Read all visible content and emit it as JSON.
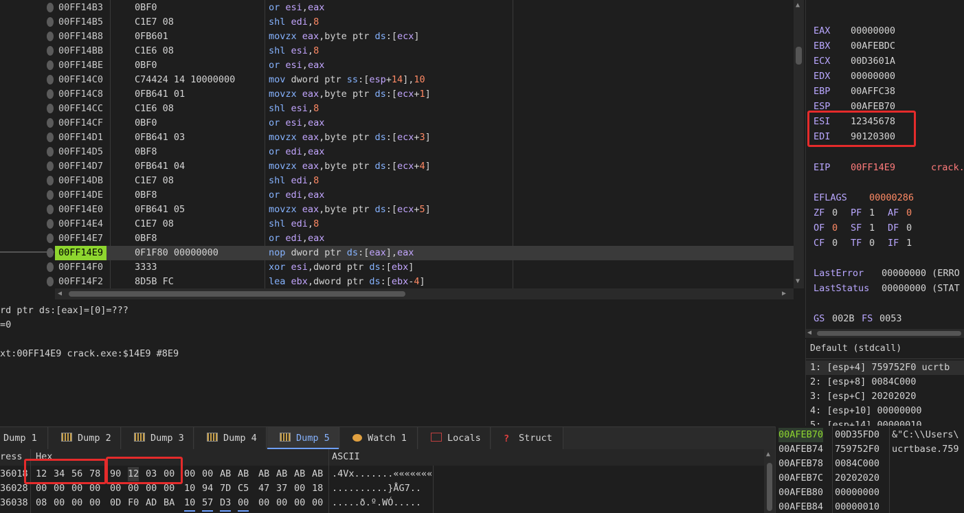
{
  "disasm": {
    "rows": [
      {
        "addr": "00FF14B3",
        "bytes": "0BF0",
        "instr": "or esi,eax"
      },
      {
        "addr": "00FF14B5",
        "bytes": "C1E7 08",
        "instr": "shl edi,8"
      },
      {
        "addr": "00FF14B8",
        "bytes": "0FB601",
        "instr": "movzx eax,byte ptr ds:[ecx]"
      },
      {
        "addr": "00FF14BB",
        "bytes": "C1E6 08",
        "instr": "shl esi,8"
      },
      {
        "addr": "00FF14BE",
        "bytes": "0BF0",
        "instr": "or esi,eax"
      },
      {
        "addr": "00FF14C0",
        "bytes": "C74424 14 10000000",
        "instr": "mov dword ptr ss:[esp+14],10"
      },
      {
        "addr": "00FF14C8",
        "bytes": "0FB641 01",
        "instr": "movzx eax,byte ptr ds:[ecx+1]"
      },
      {
        "addr": "00FF14CC",
        "bytes": "C1E6 08",
        "instr": "shl esi,8"
      },
      {
        "addr": "00FF14CF",
        "bytes": "0BF0",
        "instr": "or esi,eax"
      },
      {
        "addr": "00FF14D1",
        "bytes": "0FB641 03",
        "instr": "movzx eax,byte ptr ds:[ecx+3]"
      },
      {
        "addr": "00FF14D5",
        "bytes": "0BF8",
        "instr": "or edi,eax"
      },
      {
        "addr": "00FF14D7",
        "bytes": "0FB641 04",
        "instr": "movzx eax,byte ptr ds:[ecx+4]"
      },
      {
        "addr": "00FF14DB",
        "bytes": "C1E7 08",
        "instr": "shl edi,8"
      },
      {
        "addr": "00FF14DE",
        "bytes": "0BF8",
        "instr": "or edi,eax"
      },
      {
        "addr": "00FF14E0",
        "bytes": "0FB641 05",
        "instr": "movzx eax,byte ptr ds:[ecx+5]"
      },
      {
        "addr": "00FF14E4",
        "bytes": "C1E7 08",
        "instr": "shl edi,8"
      },
      {
        "addr": "00FF14E7",
        "bytes": "0BF8",
        "instr": "or edi,eax"
      },
      {
        "addr": "00FF14E9",
        "bytes": "0F1F80 00000000",
        "instr": "nop dword ptr ds:[eax],eax",
        "current": true
      },
      {
        "addr": "00FF14F0",
        "bytes": "3333",
        "instr": "xor esi,dword ptr ds:[ebx]"
      },
      {
        "addr": "00FF14F2",
        "bytes": "8D5B FC",
        "instr": "lea ebx,dword ptr ds:[ebx-4]"
      }
    ]
  },
  "info": {
    "line1": "rd ptr ds:[eax]=[0]=???",
    "line2": "=0",
    "line3": "xt:00FF14E9 crack.exe:$14E9 #8E9"
  },
  "registers": {
    "gp": [
      {
        "name": "EAX",
        "value": "00000000"
      },
      {
        "name": "EBX",
        "value": "00AFEBDC"
      },
      {
        "name": "ECX",
        "value": "00D3601A"
      },
      {
        "name": "EDX",
        "value": "00000000"
      },
      {
        "name": "EBP",
        "value": "00AFFC38"
      },
      {
        "name": "ESP",
        "value": "00AFEB70"
      },
      {
        "name": "ESI",
        "value": "12345678"
      },
      {
        "name": "EDI",
        "value": "90120300"
      }
    ],
    "eip": {
      "name": "EIP",
      "value": "00FF14E9",
      "label": "crack."
    },
    "eflags": {
      "name": "EFLAGS",
      "value": "00000286"
    },
    "flags": [
      [
        {
          "n": "ZF",
          "v": "0"
        },
        {
          "n": "PF",
          "v": "1"
        },
        {
          "n": "AF",
          "v": "0"
        }
      ],
      [
        {
          "n": "OF",
          "v": "0"
        },
        {
          "n": "SF",
          "v": "1"
        },
        {
          "n": "DF",
          "v": "0"
        }
      ],
      [
        {
          "n": "CF",
          "v": "0"
        },
        {
          "n": "TF",
          "v": "0"
        },
        {
          "n": "IF",
          "v": "1"
        }
      ]
    ],
    "lasterror": {
      "name": "LastError",
      "value": "00000000 (ERRO"
    },
    "laststatus": {
      "name": "LastStatus",
      "value": "00000000 (STAT"
    },
    "seg": {
      "gs_name": "GS",
      "gs": "002B",
      "fs_name": "FS",
      "fs": "0053"
    }
  },
  "callconv": {
    "title": "Default (stdcall)",
    "args": [
      "1: [esp+4] 759752F0 ucrtb",
      "2: [esp+8] 0084C000",
      "3: [esp+C] 20202020",
      "4: [esp+10] 00000000",
      "5: [esp+14] 00000010"
    ]
  },
  "tabs": [
    {
      "label": "Dump 1"
    },
    {
      "label": "Dump 2"
    },
    {
      "label": "Dump 3"
    },
    {
      "label": "Dump 4"
    },
    {
      "label": "Dump 5",
      "active": true
    },
    {
      "label": "Watch 1"
    },
    {
      "label": "Locals"
    },
    {
      "label": "Struct"
    }
  ],
  "dump": {
    "headers": {
      "address": "ress",
      "hex": "Hex",
      "ascii": "ASCII"
    },
    "rows": [
      {
        "addr": "36018",
        "hex": [
          "12",
          "34",
          "56",
          "78",
          "90",
          "12",
          "03",
          "00",
          "00",
          "00",
          "AB",
          "AB",
          "AB",
          "AB",
          "AB",
          "AB"
        ],
        "ascii": ".4Vx.......«««««««"
      },
      {
        "addr": "36028",
        "hex": [
          "00",
          "00",
          "00",
          "00",
          "00",
          "00",
          "00",
          "00",
          "10",
          "94",
          "7D",
          "C5",
          "47",
          "37",
          "00",
          "18"
        ],
        "ascii": "..........}ÅG7.."
      },
      {
        "addr": "36038",
        "hex": [
          "08",
          "00",
          "00",
          "00",
          "0D",
          "F0",
          "AD",
          "BA",
          "10",
          "57",
          "D3",
          "00",
          "00",
          "00",
          "00",
          "00"
        ],
        "ascii": ".....ð.º.WÓ....."
      }
    ]
  },
  "stack": {
    "rows": [
      {
        "addr": "00AFEB70",
        "value": "00D35FD0",
        "comment": "&\"C:\\\\Users\\",
        "current": true
      },
      {
        "addr": "00AFEB74",
        "value": "759752F0",
        "comment": "ucrtbase.759"
      },
      {
        "addr": "00AFEB78",
        "value": "0084C000",
        "comment": ""
      },
      {
        "addr": "00AFEB7C",
        "value": "20202020",
        "comment": ""
      },
      {
        "addr": "00AFEB80",
        "value": "00000000",
        "comment": ""
      },
      {
        "addr": "00AFEB84",
        "value": "00000010",
        "comment": ""
      }
    ]
  },
  "colors": {
    "accent": "#86b3ff",
    "current_addr": "#8ed62f",
    "highlight_box": "#e52b2b",
    "eip": "#ff7b7b"
  }
}
